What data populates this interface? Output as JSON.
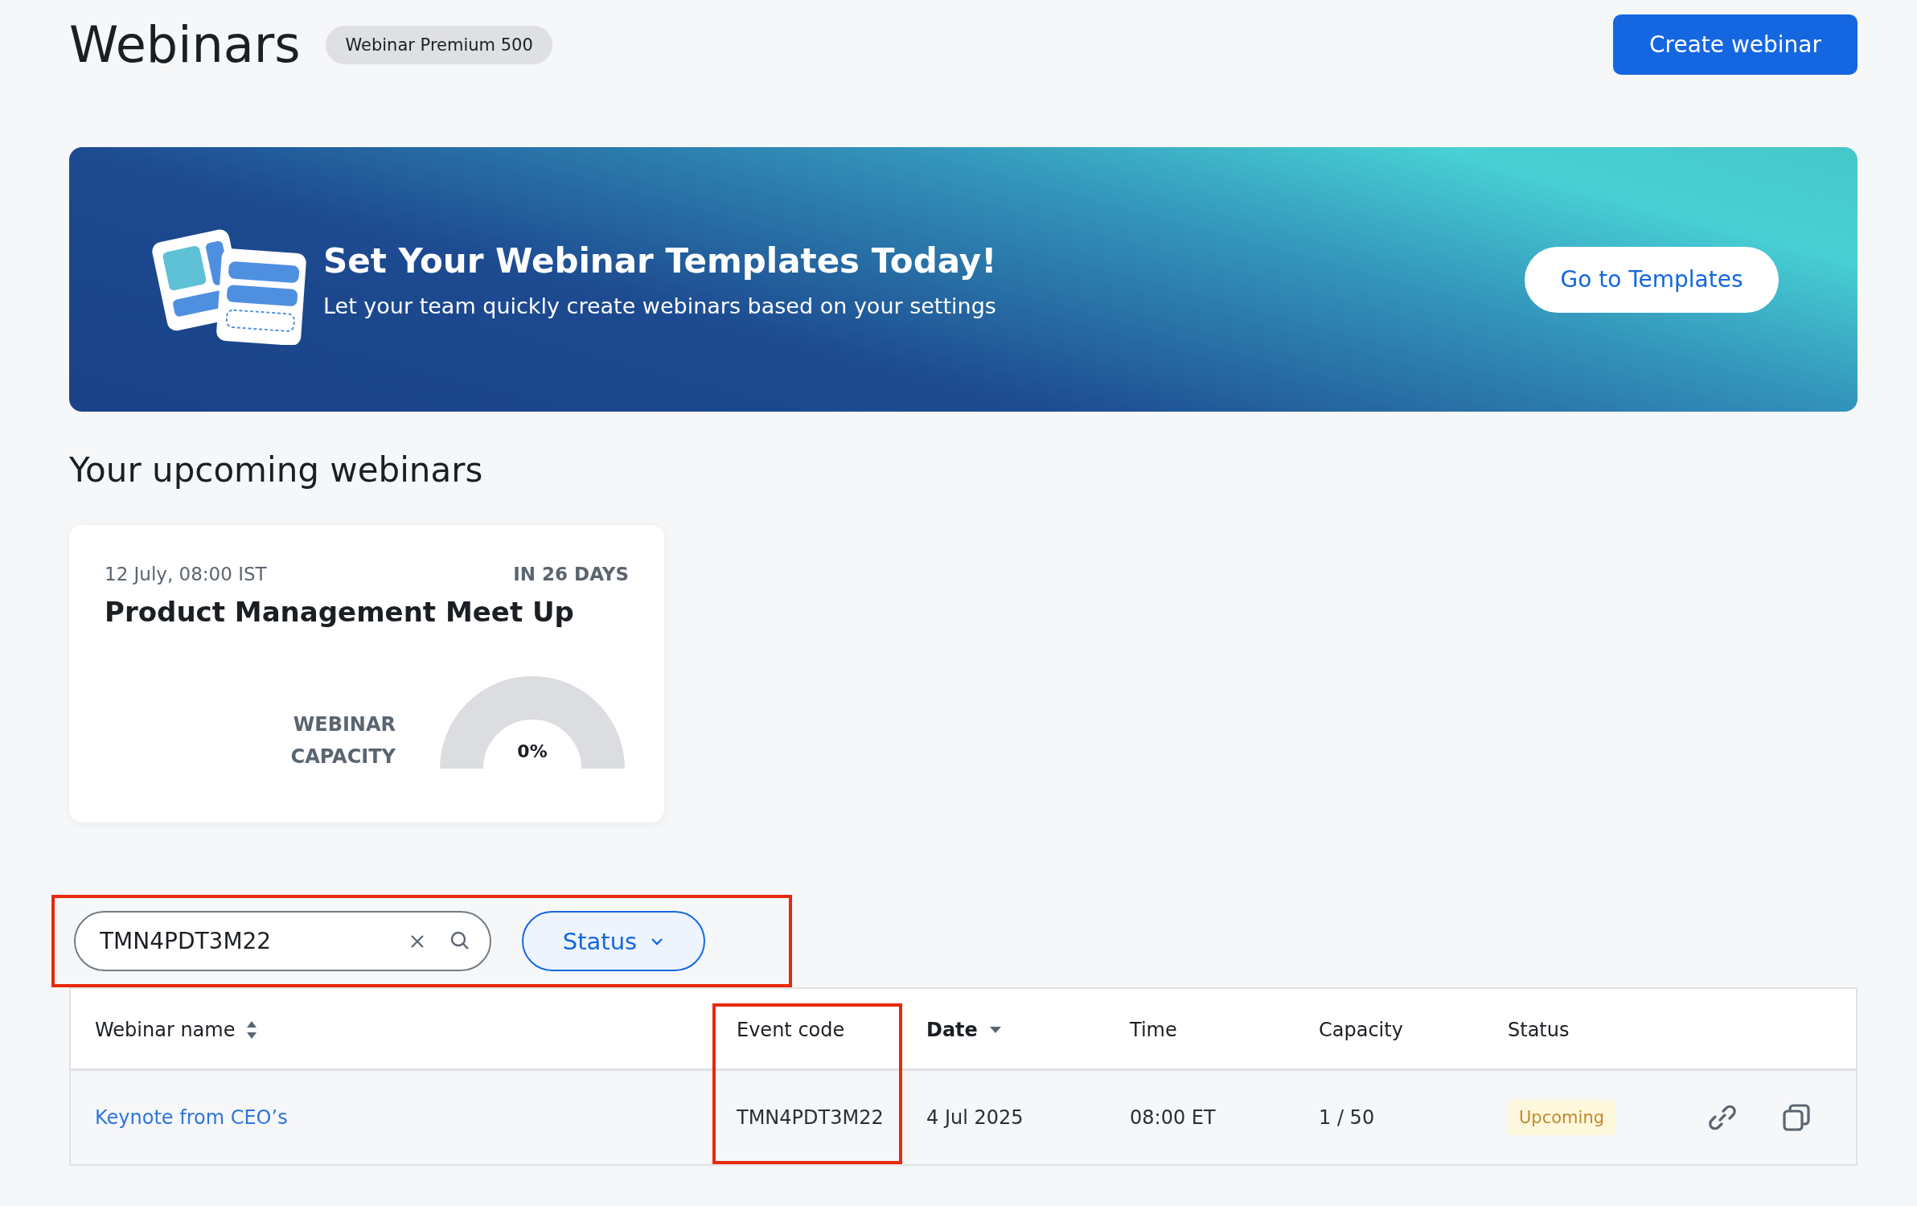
{
  "page": {
    "title": "Webinars",
    "plan_badge": "Webinar Premium 500",
    "create_button": "Create webinar"
  },
  "banner": {
    "title": "Set Your Webinar Templates Today!",
    "subtitle": "Let your team quickly create webinars based on your settings",
    "button": "Go to Templates"
  },
  "upcoming": {
    "heading": "Your upcoming webinars",
    "cards": [
      {
        "datetime": "12 July, 08:00 IST",
        "countdown": "IN 26 DAYS",
        "title": "Product Management Meet Up",
        "capacity_label": "WEBINAR CAPACITY",
        "capacity_reading": "0%",
        "level": 0
      }
    ]
  },
  "filters": {
    "highlighted": true,
    "search": {
      "value": "TMN4PDT3M22"
    },
    "status_button": "Status"
  },
  "table": {
    "columns": [
      {
        "label": "Webinar name",
        "sortable": true,
        "sorted": false,
        "highlighted": false
      },
      {
        "label": "Event code",
        "sortable": false,
        "sorted": false,
        "highlighted": true
      },
      {
        "label": "Date",
        "sortable": false,
        "sorted": true,
        "highlighted": false
      },
      {
        "label": "Time",
        "sortable": false,
        "sorted": false,
        "highlighted": false
      },
      {
        "label": "Capacity",
        "sortable": false,
        "sorted": false,
        "highlighted": false
      },
      {
        "label": "Status",
        "sortable": false,
        "sorted": false,
        "highlighted": false
      }
    ],
    "rows": [
      {
        "name": "Keynote from CEO’s",
        "event_code": "TMN4PDT3M22",
        "date": "4 Jul 2025",
        "time": "08:00 ET",
        "capacity": "1 / 50",
        "status": "Upcoming"
      }
    ]
  }
}
